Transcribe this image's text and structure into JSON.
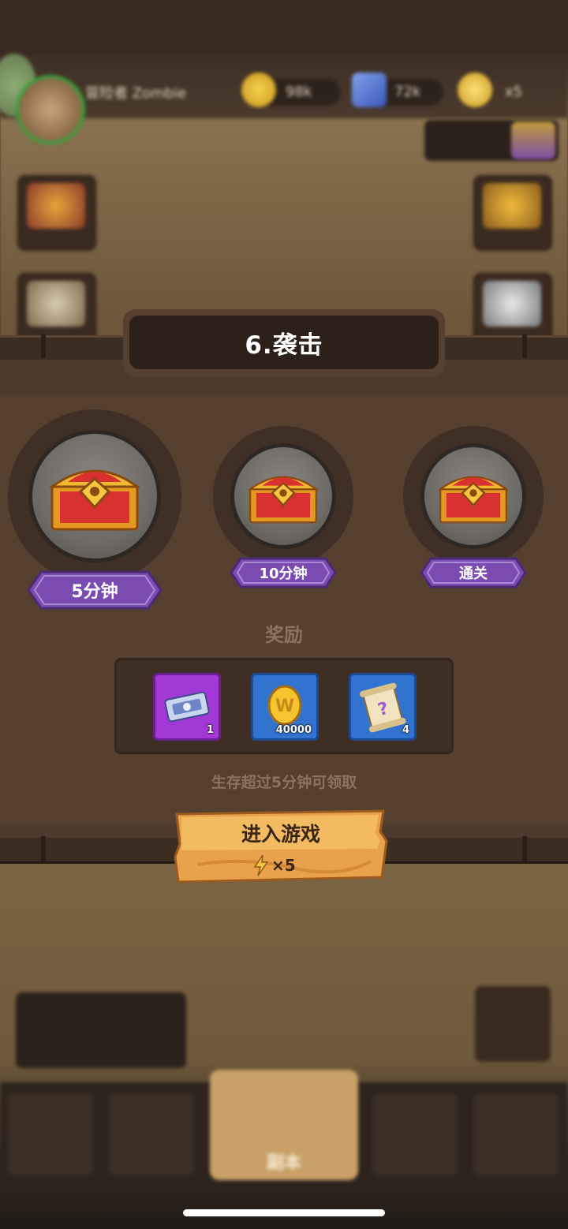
{
  "top_bar": {
    "player_name": "冒险者 Zombie",
    "gold": "98k",
    "gems": "72k",
    "energy": "x5"
  },
  "level_card": {
    "title": "6.袭击",
    "chests": [
      {
        "label": "5分钟",
        "selected": true
      },
      {
        "label": "10分钟",
        "selected": false
      },
      {
        "label": "通关",
        "selected": false
      }
    ],
    "rewards_title": "奖励",
    "rewards": [
      {
        "icon": "ticket-icon",
        "qty": "1",
        "color": "#9b30c8"
      },
      {
        "icon": "gold-coin-icon",
        "qty": "40000",
        "color": "#2d6bc4"
      },
      {
        "icon": "mystery-scroll-icon",
        "qty": "4",
        "color": "#2d6bc4"
      }
    ],
    "hint": "生存超过5分钟可领取",
    "enter_button": {
      "label": "进入游戏",
      "cost": "×5"
    }
  },
  "bottom_nav": {
    "active_label": "副本"
  },
  "colors": {
    "tag_purple": "#7b4fb4",
    "button_orange": "#e7a24a"
  }
}
